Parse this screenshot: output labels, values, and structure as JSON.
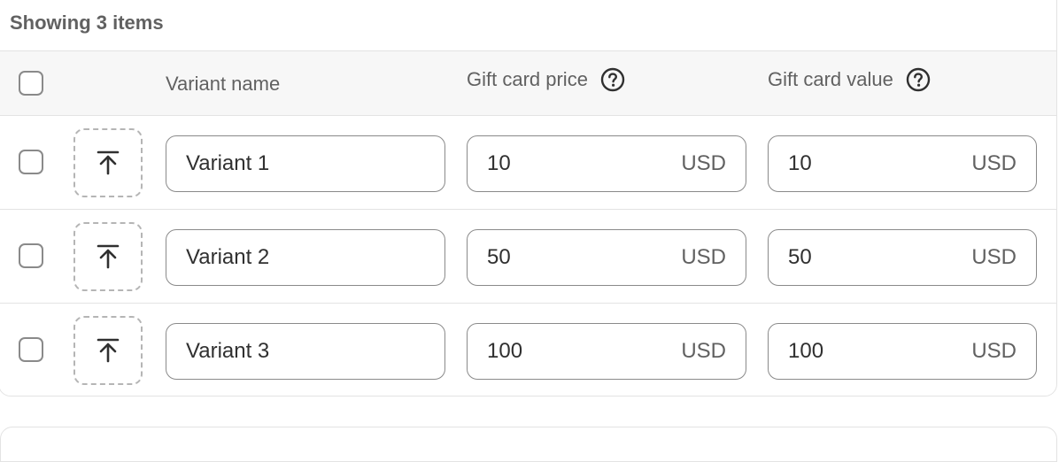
{
  "summary": "Showing 3 items",
  "columns": {
    "name": "Variant name",
    "price": "Gift card price",
    "value": "Gift card value"
  },
  "icons": {
    "help": "question-circle-icon",
    "upload": "upload-arrow-icon"
  },
  "rows": [
    {
      "name": "Variant 1",
      "price": "10",
      "price_currency": "USD",
      "value": "10",
      "value_currency": "USD"
    },
    {
      "name": "Variant 2",
      "price": "50",
      "price_currency": "USD",
      "value": "50",
      "value_currency": "USD"
    },
    {
      "name": "Variant 3",
      "price": "100",
      "price_currency": "USD",
      "value": "100",
      "value_currency": "USD"
    }
  ]
}
